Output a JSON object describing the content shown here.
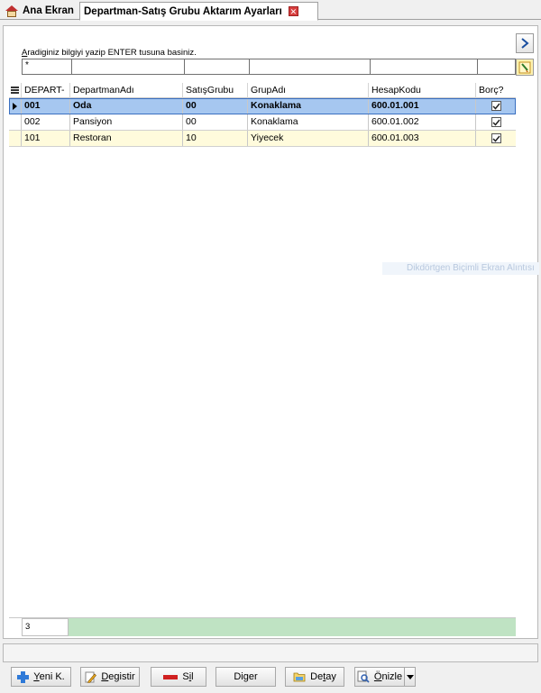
{
  "tabs": {
    "home_label": "Ana Ekran",
    "active_label": "Departman-Satış Grubu Aktarım Ayarları",
    "close_glyph": "✕"
  },
  "search": {
    "hint_first": "A",
    "hint_rest": "radiginiz bilgiyi yazip ENTER tusuna basiniz.",
    "filter_values": [
      "*",
      "",
      "",
      "",
      "",
      ""
    ]
  },
  "grid": {
    "columns": [
      "DEPART-",
      "DepartmanAdı",
      "SatışGrubu",
      "GrupAdı",
      "HesapKodu",
      "Borç?"
    ],
    "rows": [
      {
        "depart": "001",
        "adi": "Oda",
        "satis": "00",
        "grup": "Konaklama",
        "hesap": "600.01.001",
        "borc": true
      },
      {
        "depart": "002",
        "adi": "Pansiyon",
        "satis": "00",
        "grup": "Konaklama",
        "hesap": "600.01.002",
        "borc": true
      },
      {
        "depart": "101",
        "adi": "Restoran",
        "satis": "10",
        "grup": "Yiyecek",
        "hesap": "600.01.003",
        "borc": true
      }
    ],
    "footer_count": "3"
  },
  "ghost_text": "Dikdörtgen Biçimli Ekran Alıntısı",
  "toolbar": {
    "yeni_u": "Y",
    "yeni_rest": "eni K.",
    "degistir_u": "D",
    "degistir_rest": "egistir",
    "sil_pre": "S",
    "sil_u": "i",
    "sil_rest": "l",
    "diger_pre": "Di",
    "diger_u": "g",
    "diger_rest": "er",
    "detay_pre": "De",
    "detay_u": "t",
    "detay_rest": "ay",
    "onizle_u": "Ö",
    "onizle_rest": "nizle"
  }
}
